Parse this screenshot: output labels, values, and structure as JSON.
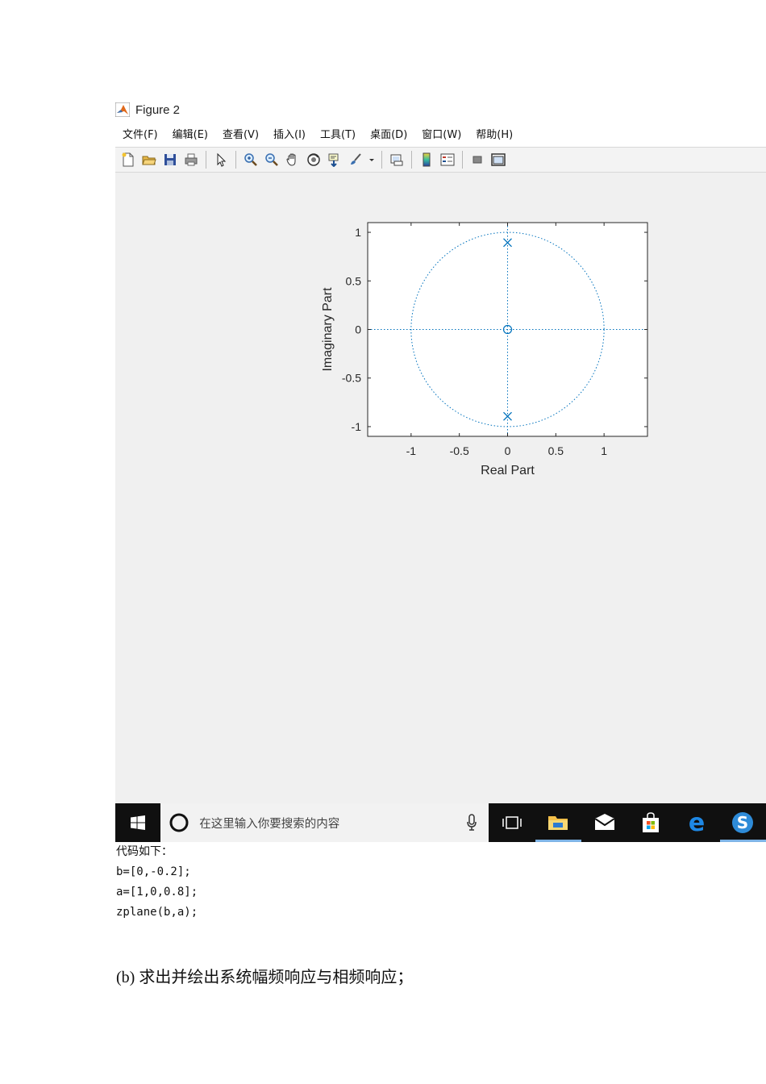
{
  "figure_window": {
    "title": "Figure 2",
    "menu": [
      "文件(F)",
      "编辑(E)",
      "查看(V)",
      "插入(I)",
      "工具(T)",
      "桌面(D)",
      "窗口(W)",
      "帮助(H)"
    ],
    "toolbar_icons": [
      "new-figure-icon",
      "open-file-icon",
      "save-icon",
      "print-icon",
      "pointer-icon",
      "zoom-in-icon",
      "zoom-out-icon",
      "pan-hand-icon",
      "rotate-3d-icon",
      "data-cursor-icon",
      "brush-icon",
      "dropdown-arrow-icon",
      "link-plot-icon",
      "colorbar-icon",
      "legend-icon",
      "hide-tools-icon",
      "dock-icon"
    ]
  },
  "chart_data": {
    "type": "scatter",
    "title": "",
    "xlabel": "Real Part",
    "ylabel": "Imaginary Part",
    "xlim": [
      -1.45,
      1.45
    ],
    "ylim": [
      -1.1,
      1.1
    ],
    "xticks": [
      "-1",
      "-0.5",
      "0",
      "0.5",
      "1"
    ],
    "yticks": [
      "1",
      "0.5",
      "0",
      "-0.5",
      "-1"
    ],
    "grid": false,
    "unit_circle": true,
    "zeros": [
      {
        "re": 0,
        "im": 0
      }
    ],
    "poles": [
      {
        "re": 0,
        "im": 0.894
      },
      {
        "re": 0,
        "im": -0.894
      }
    ],
    "marker_color": "#0072bd"
  },
  "taskbar": {
    "search_placeholder": "在这里输入你要搜索的内容",
    "icons": [
      "windows-start-icon",
      "cortana-icon",
      "microphone-icon",
      "task-view-icon",
      "file-explorer-icon",
      "mail-icon",
      "store-icon",
      "edge-icon",
      "sogou-icon"
    ]
  },
  "document": {
    "code_intro": "代码如下：",
    "code_lines": [
      "b=[0,-0.2];",
      "a=[1,0,0.8];",
      "zplane(b,a);"
    ],
    "section_b": "(b) 求出并绘出系统幅频响应与相频响应；"
  }
}
